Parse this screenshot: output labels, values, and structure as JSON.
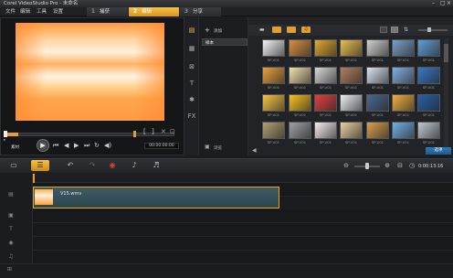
{
  "window": {
    "title": "Corel VideoStudio Pro - 未命名"
  },
  "menu": {
    "items": [
      "文件",
      "编辑",
      "工具",
      "设置"
    ]
  },
  "steps": [
    {
      "num": "1",
      "label": "捕获"
    },
    {
      "num": "2",
      "label": "编辑"
    },
    {
      "num": "3",
      "label": "分享"
    }
  ],
  "preview": {
    "mode_label": "素材",
    "timecode": "00:00:00:00"
  },
  "library": {
    "add_label": "添加",
    "folder_label": "样本",
    "options_label": "浏览",
    "thumb_label": "SP-V01",
    "options_button": "选项"
  },
  "timeline": {
    "clip_label": "V15.wmv",
    "duration": "0:00:13:16"
  },
  "colors": {
    "accent": "#e6a51c",
    "clip": "#3d5a66"
  }
}
